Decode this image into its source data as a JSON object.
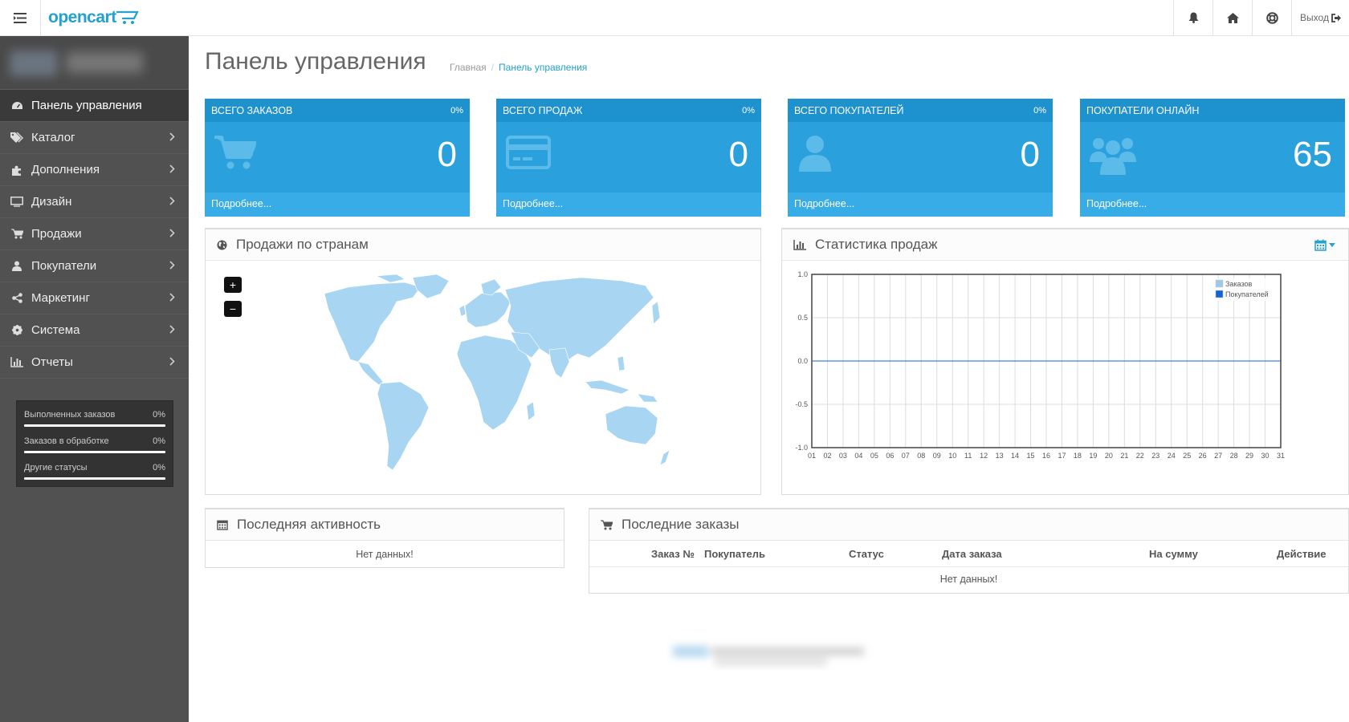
{
  "header": {
    "logo": "opencart",
    "logout_label": "Выход"
  },
  "sidebar": {
    "items": [
      {
        "label": "Панель управления",
        "icon": "dashboard-icon",
        "active": true
      },
      {
        "label": "Каталог",
        "icon": "tags-icon"
      },
      {
        "label": "Дополнения",
        "icon": "puzzle-icon"
      },
      {
        "label": "Дизайн",
        "icon": "monitor-icon"
      },
      {
        "label": "Продажи",
        "icon": "cart-icon"
      },
      {
        "label": "Покупатели",
        "icon": "user-icon"
      },
      {
        "label": "Маркетинг",
        "icon": "share-icon"
      },
      {
        "label": "Система",
        "icon": "gear-icon"
      },
      {
        "label": "Отчеты",
        "icon": "bar-chart-icon"
      }
    ],
    "progress": [
      {
        "label": "Выполненных заказов",
        "pct": "0%"
      },
      {
        "label": "Заказов в обработке",
        "pct": "0%"
      },
      {
        "label": "Другие статусы",
        "pct": "0%"
      }
    ]
  },
  "page": {
    "title": "Панель управления",
    "breadcrumb": [
      "Главная",
      "Панель управления"
    ]
  },
  "tiles": [
    {
      "title": "ВСЕГО ЗАКАЗОВ",
      "pct": "0%",
      "value": "0",
      "more": "Подробнее..."
    },
    {
      "title": "ВСЕГО ПРОДАЖ",
      "pct": "0%",
      "value": "0",
      "more": "Подробнее..."
    },
    {
      "title": "ВСЕГО ПОКУПАТЕЛЕЙ",
      "pct": "0%",
      "value": "0",
      "more": "Подробнее..."
    },
    {
      "title": "ПОКУПАТЕЛИ ОНЛАЙН",
      "pct": "",
      "value": "65",
      "more": "Подробнее..."
    }
  ],
  "map_panel": {
    "title": "Продажи по странам",
    "zoom_in": "+",
    "zoom_out": "−"
  },
  "stats_panel": {
    "title": "Статистика продаж"
  },
  "chart_data": {
    "type": "line",
    "title": "",
    "x": [
      "01",
      "02",
      "03",
      "04",
      "05",
      "06",
      "07",
      "08",
      "09",
      "10",
      "11",
      "12",
      "13",
      "14",
      "15",
      "16",
      "17",
      "18",
      "19",
      "20",
      "21",
      "22",
      "23",
      "24",
      "25",
      "26",
      "27",
      "28",
      "29",
      "30",
      "31"
    ],
    "series": [
      {
        "name": "Заказов",
        "color": "#9acae6",
        "values": [
          0,
          0,
          0,
          0,
          0,
          0,
          0,
          0,
          0,
          0,
          0,
          0,
          0,
          0,
          0,
          0,
          0,
          0,
          0,
          0,
          0,
          0,
          0,
          0,
          0,
          0,
          0,
          0,
          0,
          0,
          0
        ]
      },
      {
        "name": "Покупателей",
        "color": "#1065d2",
        "values": [
          0,
          0,
          0,
          0,
          0,
          0,
          0,
          0,
          0,
          0,
          0,
          0,
          0,
          0,
          0,
          0,
          0,
          0,
          0,
          0,
          0,
          0,
          0,
          0,
          0,
          0,
          0,
          0,
          0,
          0,
          0
        ]
      }
    ],
    "yticks": [
      "1.0",
      "0.5",
      "0.0",
      "-0.5",
      "-1.0"
    ],
    "ylim": [
      -1,
      1
    ],
    "grid": true,
    "legend": "top-right"
  },
  "activity_panel": {
    "title": "Последняя активность",
    "empty": "Нет данных!"
  },
  "orders_panel": {
    "title": "Последние заказы",
    "columns": [
      "Заказ №",
      "Покупатель",
      "Статус",
      "Дата заказа",
      "На сумму",
      "Действие"
    ],
    "empty": "Нет данных!"
  },
  "colors": {
    "accent": "#23a1d1",
    "tile_bg": "#2aa1dd",
    "tile_head": "#1e91cf",
    "sidebar": "#515151",
    "map_land": "#a8d6f2"
  }
}
